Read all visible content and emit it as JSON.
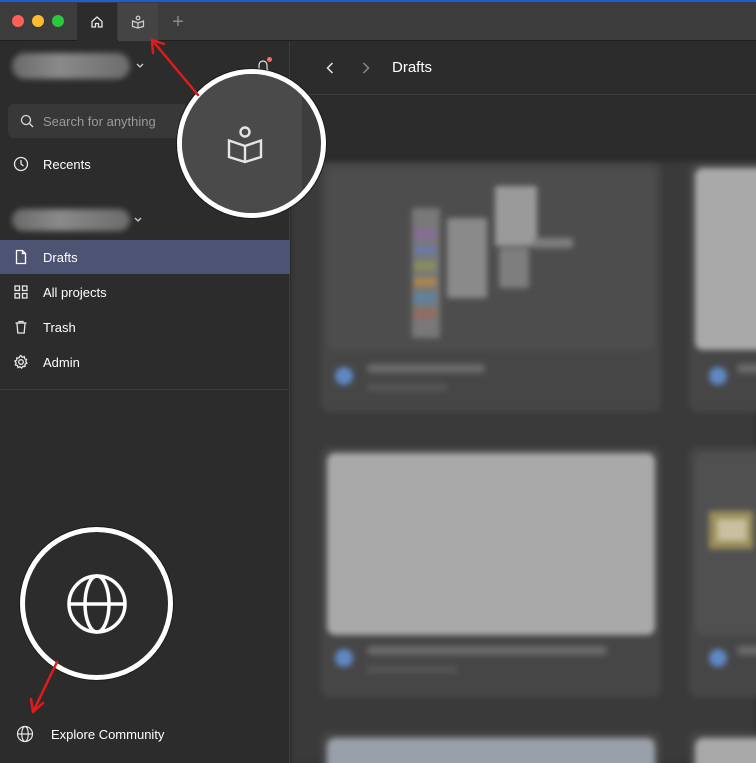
{
  "titlebar": {
    "tabs": [
      {
        "name": "home",
        "icon": "home-icon"
      },
      {
        "name": "community",
        "icon": "community-book-icon"
      }
    ],
    "add_tab_symbol": "+"
  },
  "sidebar": {
    "search_placeholder": "Search for anything",
    "recents_label": "Recents",
    "items": [
      {
        "label": "Drafts",
        "icon": "file-icon",
        "active": true
      },
      {
        "label": "All projects",
        "icon": "grid-icon",
        "active": false
      },
      {
        "label": "Trash",
        "icon": "trash-icon",
        "active": false
      },
      {
        "label": "Admin",
        "icon": "gear-icon",
        "active": false
      }
    ],
    "explore_label": "Explore Community"
  },
  "main": {
    "title": "Drafts"
  },
  "colors": {
    "sidebar_bg": "#2c2c2c",
    "active_item": "#4d5373",
    "titlebar_bg": "#3c3c3c",
    "arrow": "#e01b1b",
    "callout_ring": "#ffffff"
  }
}
